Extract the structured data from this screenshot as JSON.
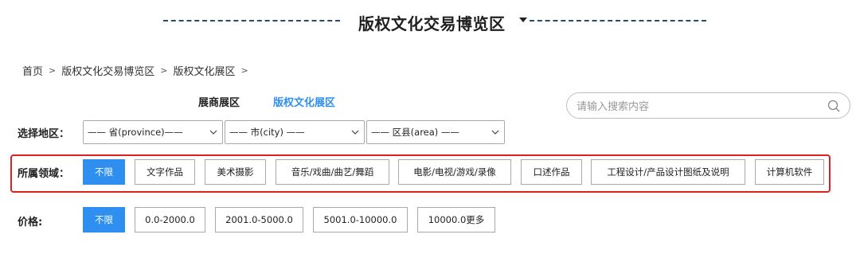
{
  "header": {
    "title": "版权文化交易博览区"
  },
  "breadcrumb": {
    "items": [
      "首页",
      "版权文化交易博览区",
      "版权文化展区"
    ],
    "separator": ">"
  },
  "section_tabs": [
    {
      "label": "展商展区",
      "active": false
    },
    {
      "label": "版权文化展区",
      "active": true
    }
  ],
  "search": {
    "placeholder": "请输入搜索内容",
    "value": ""
  },
  "region": {
    "label": "选择地区：",
    "selects": [
      {
        "value": "—— 省(province)——"
      },
      {
        "value": "—— 市(city) ——"
      },
      {
        "value": "—— 区县(area) ——"
      }
    ]
  },
  "field": {
    "label": "所属领域：",
    "options": [
      "不限",
      "文字作品",
      "美术摄影",
      "音乐/戏曲/曲艺/舞蹈",
      "电影/电视/游戏/录像",
      "口述作品",
      "工程设计/产品设计图纸及说明",
      "计算机软件"
    ],
    "selected": "不限"
  },
  "price": {
    "label": "价格:",
    "options": [
      "不限",
      "0.0-2000.0",
      "2001.0-5000.0",
      "5001.0-10000.0",
      "10000.0更多"
    ],
    "selected": "不限"
  },
  "colors": {
    "accent": "#2e8ff0",
    "highlight_border": "#e02020",
    "dash": "#2a4a6e"
  }
}
